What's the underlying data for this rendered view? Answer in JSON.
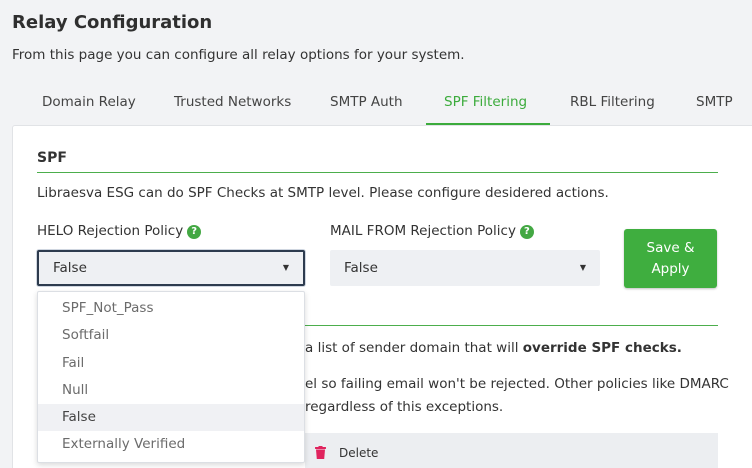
{
  "page": {
    "title": "Relay Configuration",
    "description": "From this page you can configure all relay options for your system."
  },
  "tabs": [
    {
      "label": "Domain Relay"
    },
    {
      "label": "Trusted Networks"
    },
    {
      "label": "SMTP Auth"
    },
    {
      "label": "SPF Filtering"
    },
    {
      "label": "RBL Filtering"
    },
    {
      "label": "SMTP"
    }
  ],
  "active_tab": "SPF Filtering",
  "spf": {
    "section_title": "SPF",
    "description": "Libraesva ESG can do SPF Checks at SMTP level. Please configure desidered actions.",
    "helo_label": "HELO Rejection Policy",
    "helo_value": "False",
    "mailfrom_label": "MAIL FROM Rejection Policy",
    "mailfrom_value": "False",
    "help_glyph": "?",
    "save_button_line1": "Save &",
    "save_button_line2": "Apply"
  },
  "exceptions": {
    "text1_prefix": "a list of sender domain that will ",
    "text1_bold": "override SPF checks.",
    "text2": "el so failing email won't be rejected. Other policies like DMARC",
    "text3": "regardless of this exceptions.",
    "delete_label": "Delete"
  },
  "dropdown": {
    "options": [
      "SPF_Not_Pass",
      "Softfail",
      "Fail",
      "Null",
      "False",
      "Externally Verified"
    ],
    "selected": "False"
  },
  "colors": {
    "accent": "#3cab3c",
    "danger": "#e0245e"
  },
  "icons": {
    "help": "question-circle-icon",
    "caret": "caret-down-icon",
    "delete": "trash-icon"
  }
}
